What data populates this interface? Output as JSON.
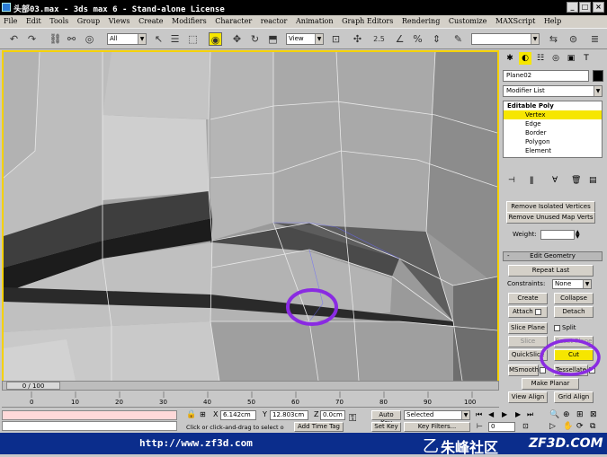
{
  "window": {
    "title": "头部03.max - 3ds max 6 - Stand-alone License"
  },
  "menu": [
    "File",
    "Edit",
    "Tools",
    "Group",
    "Views",
    "Create",
    "Modifiers",
    "Character",
    "reactor",
    "Animation",
    "Graph Editors",
    "Rendering",
    "Customize",
    "MAXScript",
    "Help"
  ],
  "toolbar": {
    "selection_filter": "All",
    "ref_coord": "View",
    "snap_value": "2.5"
  },
  "panel": {
    "object_name": "Plane02",
    "modifier_list": "Modifier List",
    "stack": {
      "top": "Editable Poly",
      "items": [
        "Vertex",
        "Edge",
        "Border",
        "Polygon",
        "Element"
      ],
      "selected": "Vertex"
    },
    "buttons": {
      "remove_isolated": "Remove Isolated Vertices",
      "remove_unused": "Remove Unused Map Verts",
      "weight_label": "Weight:",
      "edit_geometry": "Edit Geometry",
      "repeat_last": "Repeat Last",
      "constraints_label": "Constraints:",
      "constraints_value": "None",
      "create": "Create",
      "collapse": "Collapse",
      "attach": "Attach",
      "detach": "Detach",
      "slice_plane": "Slice Plane",
      "split": "Split",
      "slice": "Slice",
      "reset_plane": "Reset Plane",
      "quickslice": "QuickSlice",
      "cut": "Cut",
      "msmooth": "MSmooth",
      "tessellate": "Tessellate",
      "make_planar": "Make Planar",
      "view_align": "View Align",
      "grid_align": "Grid Align"
    }
  },
  "timeline": {
    "frame": "0 / 100",
    "ticks": [
      "0",
      "10",
      "20",
      "30",
      "40",
      "50",
      "60",
      "70",
      "80",
      "90",
      "100"
    ]
  },
  "status": {
    "x_label": "X",
    "x_value": "6.142cm",
    "y_label": "Y",
    "y_value": "12.803cm",
    "z_label": "Z",
    "z_value": "0.0cm",
    "prompt": "Click or click-and-drag to select o",
    "add_time_tag": "Add Time Tag",
    "auto_key": "Auto Key",
    "set_key": "Set Key",
    "selected": "Selected",
    "key_filters": "Key Filters...",
    "frame_field": "0"
  },
  "watermark": {
    "url": "http://www.zf3d.com",
    "brand": "朱峰社区",
    "brand_en": "ZF3D.COM"
  },
  "colors": {
    "viewport_border": "#f5d100",
    "highlight_circle": "#8a2be2",
    "selection": "#f6e600"
  }
}
